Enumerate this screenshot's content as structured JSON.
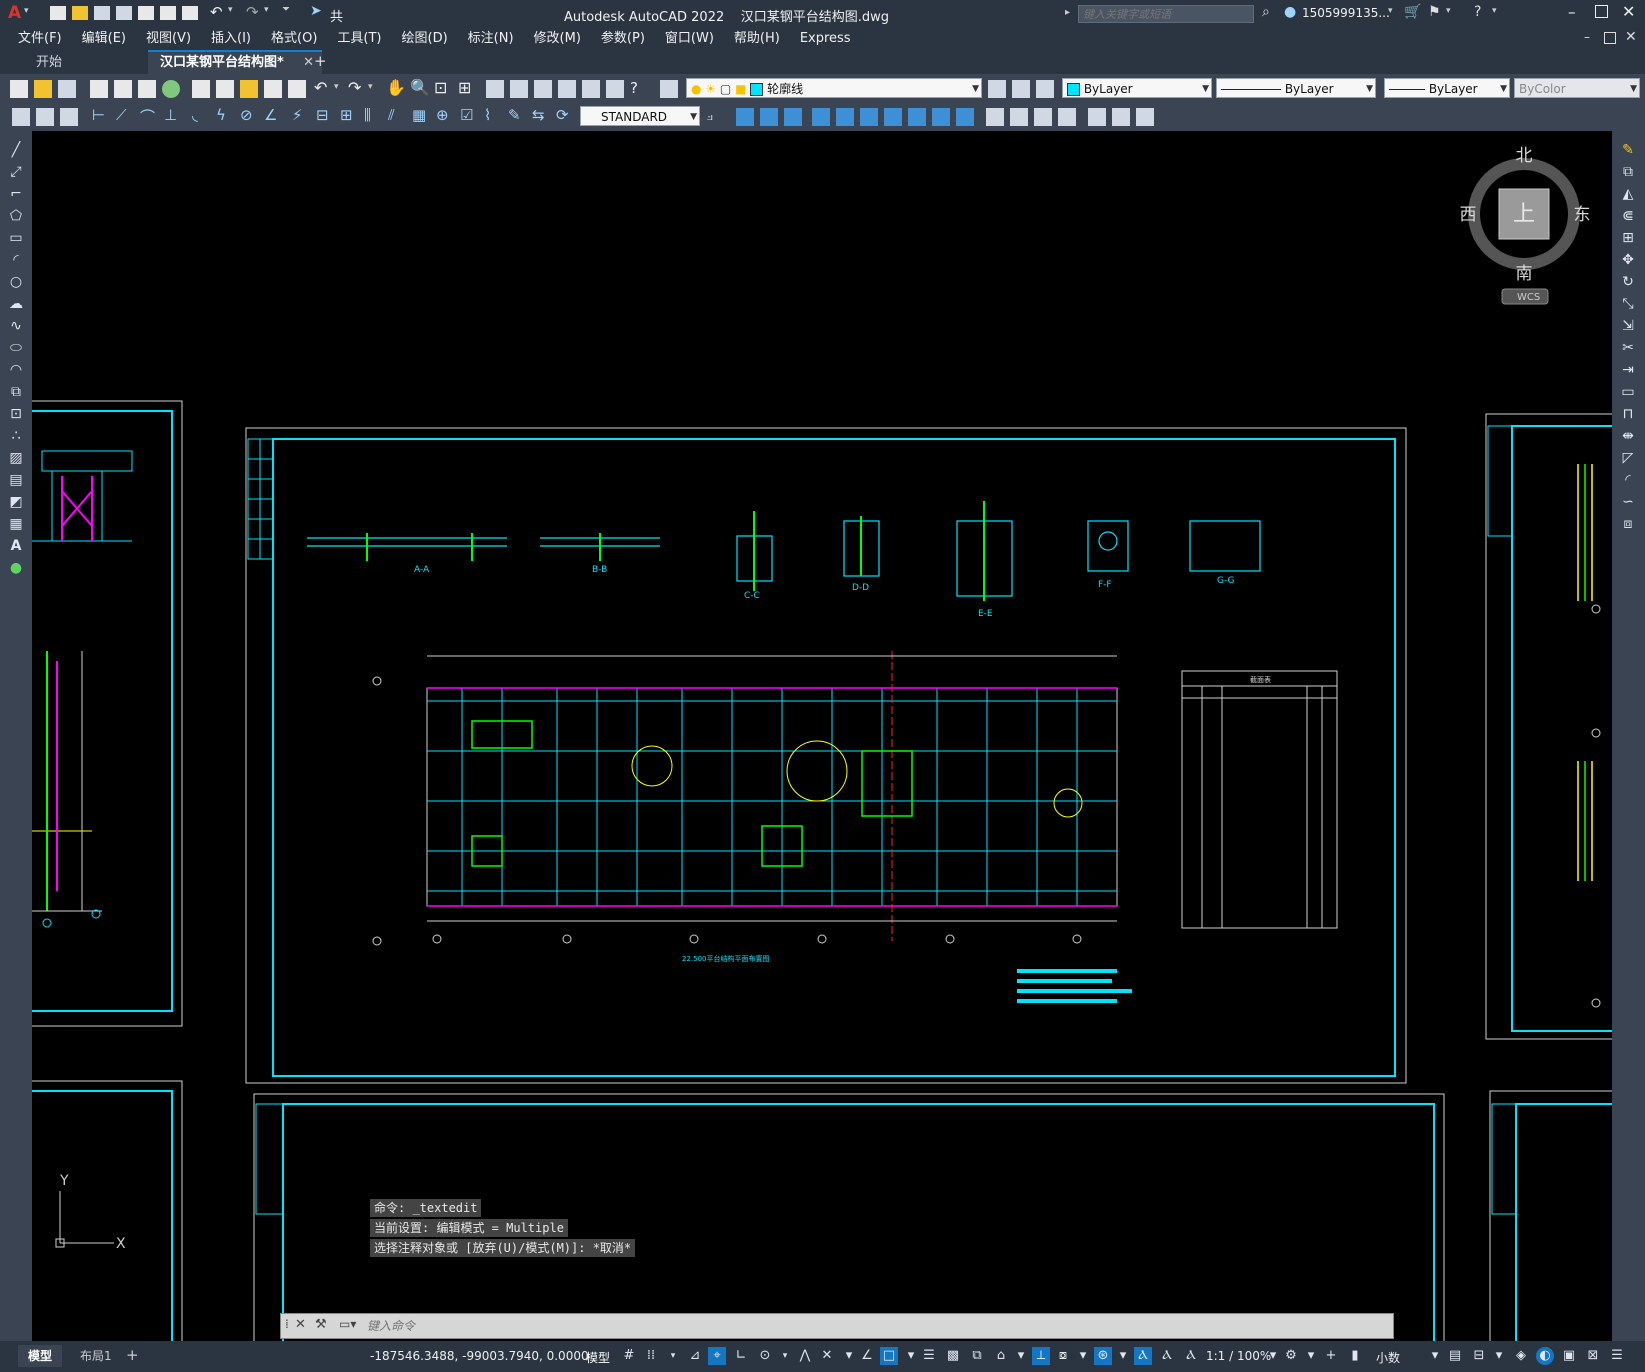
{
  "app": {
    "title": "Autodesk AutoCAD 2022    汉口某钢平台结构图.dwg",
    "search_placeholder": "键入关键字或短语",
    "user": "1505999135...",
    "share_label": "共享",
    "logo": "A"
  },
  "menu": [
    "文件(F)",
    "编辑(E)",
    "视图(V)",
    "插入(I)",
    "格式(O)",
    "工具(T)",
    "绘图(D)",
    "标注(N)",
    "修改(M)",
    "参数(P)",
    "窗口(W)",
    "帮助(H)",
    "Express"
  ],
  "tabs": [
    "开始",
    "汉口某钢平台结构图*"
  ],
  "toolbar": {
    "layer": "轮廓线",
    "color": "ByLayer",
    "linetype": "ByLayer",
    "lineweight": "ByLayer",
    "plotstyle": "ByColor",
    "textstyle": "STANDARD"
  },
  "viewcube": {
    "north": "北",
    "south": "南",
    "east": "东",
    "west": "西",
    "top": "上",
    "wcs": "WCS"
  },
  "ucs": {
    "x": "X",
    "y": "Y"
  },
  "command": {
    "history": [
      "命令: _textedit",
      "当前设置: 编辑模式 = Multiple",
      "选择注释对象或 [放弃(U)/模式(M)]: *取消*"
    ],
    "placeholder": "键入命令"
  },
  "status": {
    "layout_tabs": [
      "模型",
      "布局1"
    ],
    "coords": "-187546.3488, -99003.7940, 0.0000",
    "model": "模型",
    "scale": "1:1 / 100%",
    "units": "小数"
  },
  "drawing": {
    "sections": [
      "A-A",
      "B-B",
      "C-C",
      "D-D",
      "E-E",
      "F-F",
      "G-G"
    ],
    "table_title": "截面表",
    "plan_title": "22.500平台结构平面布置图"
  },
  "colors": {
    "chrome": "#2b3541",
    "toolbar": "#3b4452",
    "accent": "#0f80d2",
    "cyan": "#00e5ff",
    "magenta": "#ff00ff",
    "green": "#00ff00",
    "yellow": "#ffff00"
  }
}
